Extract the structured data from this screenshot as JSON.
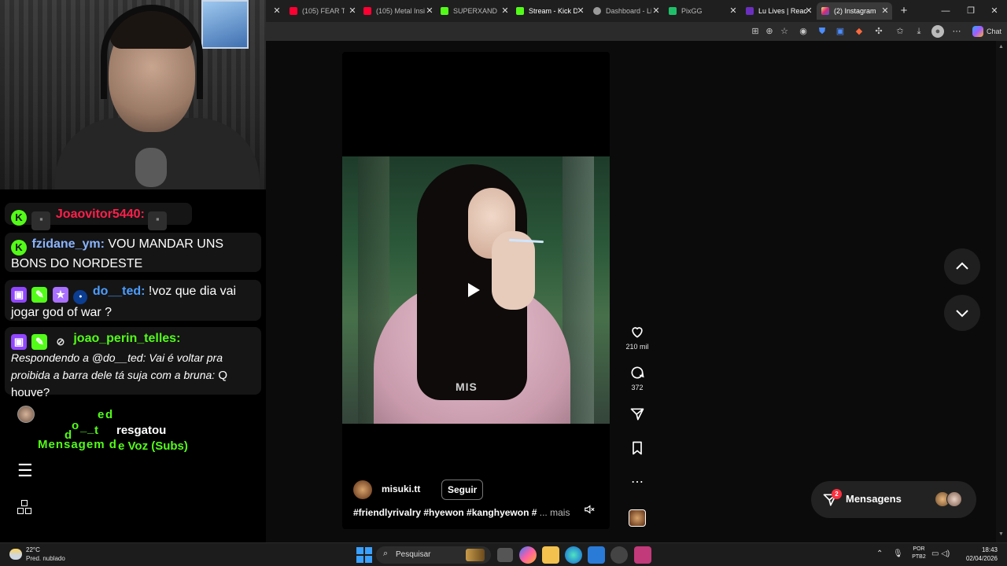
{
  "overlay": {
    "chat": [
      {
        "user": "Joaovitor5440:",
        "text": ""
      },
      {
        "user": "fzidane_ym:",
        "text": " VOU MANDAR UNS BONS DO NORDESTE"
      },
      {
        "user": "do__ted:",
        "text": " !voz que dia vai jogar god of war ?"
      },
      {
        "user": "joao_perin_telles:",
        "text": "Respondendo a @do__ted: Vai é voltar pra proibida a barra dele tá suja com a bruna:",
        "text2": " Q houve?"
      }
    ],
    "reward": {
      "wavy_user": [
        "d",
        "o",
        "_",
        "_",
        "t",
        "e",
        "d"
      ],
      "action": "resgatou",
      "wavy_reward_a": "Mensagem d",
      "reward_tail": "e Voz (Subs)"
    }
  },
  "browser": {
    "tabs": [
      {
        "label": "(105) FEAR THE",
        "color": "#ff0033"
      },
      {
        "label": "(105) Metal Insi",
        "color": "#ff0033"
      },
      {
        "label": "SUPERXANDAO",
        "color": "#53fc18"
      },
      {
        "label": "Stream - Kick Da",
        "color": "#53fc18"
      },
      {
        "label": "Dashboard - Liv",
        "color": "#9a9a9a"
      },
      {
        "label": "PixGG",
        "color": "#1fbf6a"
      },
      {
        "label": "Lu Lives | React",
        "color": "#6b2fbf"
      },
      {
        "label": "(2) Instagram",
        "color": "#e1306c"
      }
    ],
    "copilot_label": "Chat"
  },
  "reel": {
    "watermark": "MIS",
    "author": "misuki.tt",
    "follow_label": "Seguir",
    "caption": "#friendlyrivalry #hyewon #kanghyewon #",
    "more_label": "... mais",
    "likes": "210 mil",
    "comments": "372"
  },
  "messages": {
    "label": "Mensagens",
    "badge": "2"
  },
  "taskbar": {
    "temp": "22°C",
    "weather": "Pred. nublado",
    "search_placeholder": "Pesquisar",
    "lang_1": "POR",
    "lang_2": "PTB2",
    "time": "18:43",
    "date": "02/04/2026"
  }
}
